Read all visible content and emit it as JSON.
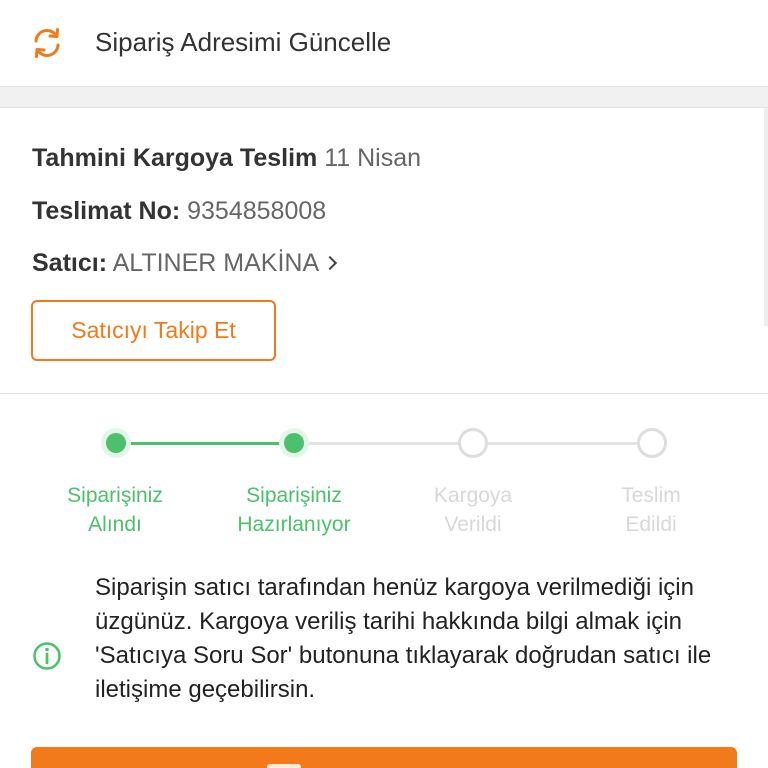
{
  "top_row": {
    "label": "Sipariş Adresimi Güncelle",
    "icon": "refresh-icon",
    "icon_color": "#f27a1a"
  },
  "shipment_info": {
    "estimated_label": "Tahmini Kargoya Teslim",
    "estimated_value": "11 Nisan",
    "delivery_no_label": "Teslimat No:",
    "delivery_no_value": "9354858008",
    "seller_label": "Satıcı:",
    "seller_value": "ALTINER MAKİNA"
  },
  "follow_button": {
    "label": "Satıcıyı Takip Et"
  },
  "stepper": {
    "active_color": "#4cc06a",
    "inactive_color": "#dddddd",
    "current_step": 2,
    "steps": [
      {
        "label": "Siparişiniz\nAlındı",
        "status": "done"
      },
      {
        "label": "Siparişiniz\nHazırlanıyor",
        "status": "done"
      },
      {
        "label": "Kargoya\nVerildi",
        "status": "pending"
      },
      {
        "label": "Teslim\nEdildi",
        "status": "pending"
      }
    ]
  },
  "notice": {
    "icon": "info-circle-icon",
    "text": "Siparişin satıcı tarafından henüz kargoya verilmediği için üzgünüz. Kargoya veriliş tarihi hakkında bilgi almak için 'Satıcıya Soru Sor' butonuna tıklayarak doğrudan satıcı ile iletişime geçebilirsin."
  },
  "cta": {
    "color": "#f27a1a"
  }
}
